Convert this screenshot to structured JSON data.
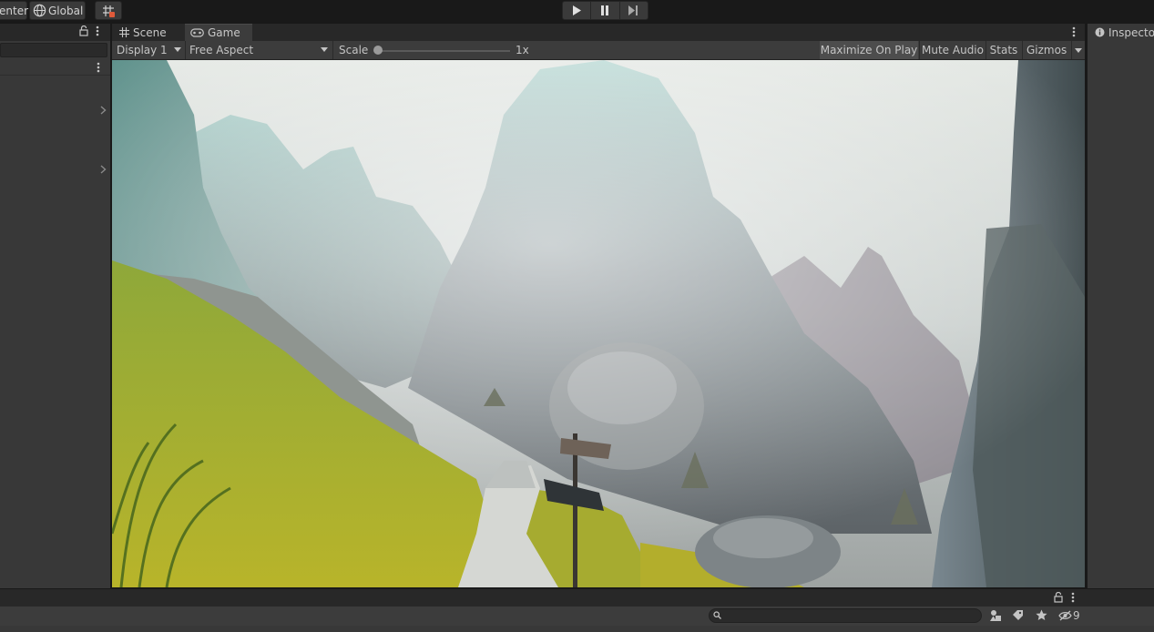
{
  "toolbar": {
    "pivot_label": "enter",
    "space_label": "Global",
    "grid_icon": "grid-snap-icon",
    "play_icon": "play-icon",
    "pause_icon": "pause-icon",
    "step_icon": "step-icon"
  },
  "tabs": [
    {
      "label": "Scene",
      "icon": "grid-icon",
      "active": false
    },
    {
      "label": "Game",
      "icon": "gamepad-icon",
      "active": true
    }
  ],
  "game_toolbar": {
    "display": "Display 1",
    "aspect": "Free Aspect",
    "scale_label": "Scale",
    "scale_value": "1x",
    "scale_level": 0,
    "maximize": "Maximize On Play",
    "mute": "Mute Audio",
    "stats": "Stats",
    "gizmos": "Gizmos"
  },
  "inspector": {
    "tab_label": "Inspecto",
    "icon": "info-icon"
  },
  "bottom": {
    "hidden_count": "9"
  },
  "colors": {
    "accent_tab": "#3c3c3c",
    "panel_bg": "#383838",
    "toolbar_bg": "#191919",
    "play_gizmo_accent": "#e05a3a"
  }
}
